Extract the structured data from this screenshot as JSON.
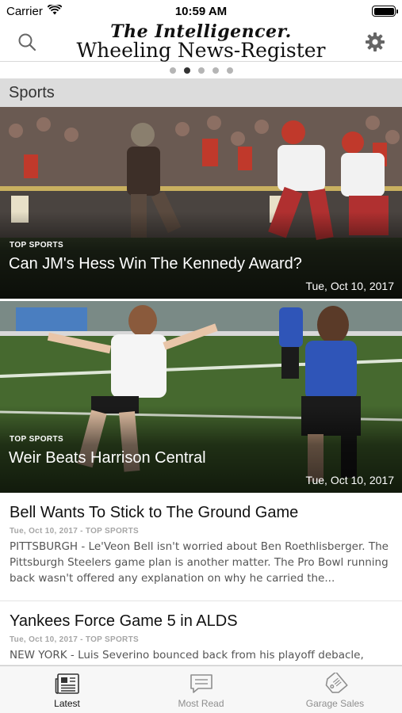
{
  "status_bar": {
    "carrier": "Carrier",
    "time": "10:59 AM"
  },
  "header": {
    "masthead_line1": "The Intelligencer.",
    "masthead_line2": "Wheeling News-Register",
    "left_icon": "search-icon",
    "right_icon": "gear-icon"
  },
  "page_indicator": {
    "count": 5,
    "active_index": 1
  },
  "section": {
    "title": "Sports"
  },
  "featured": [
    {
      "tag": "TOP SPORTS",
      "title": "Can JM's Hess Win The Kennedy Award?",
      "date": "Tue, Oct 10, 2017"
    },
    {
      "tag": "TOP SPORTS",
      "title": "Weir Beats Harrison Central",
      "date": "Tue, Oct 10, 2017"
    }
  ],
  "articles": [
    {
      "title": "Bell Wants To Stick to The Ground Game",
      "meta": "Tue, Oct 10, 2017 - TOP SPORTS",
      "snippet": "PITTSBURGH - Le'Veon Bell isn't worried about Ben Roethlisberger. The Pittsburgh Steelers game plan is another matter. The Pro Bowl running back wasn't offered any explanation on why he carried the..."
    },
    {
      "title": "Yankees Force Game 5 in ALDS",
      "meta": "Tue, Oct 10, 2017 - TOP SPORTS",
      "snippet": "NEW YORK - Luis Severino bounced back from his playoff debacle,"
    }
  ],
  "tabs": [
    {
      "label": "Latest",
      "icon": "newspaper-icon",
      "active": true
    },
    {
      "label": "Most Read",
      "icon": "chat-bubble-icon",
      "active": false
    },
    {
      "label": "Garage Sales",
      "icon": "price-tag-icon",
      "active": false
    }
  ],
  "colors": {
    "section_header_bg": "#dcdcdc",
    "active_dot": "#333333",
    "inactive_dot": "#b5b5b5",
    "tab_active": "#111111",
    "tab_inactive": "#8e8e8e"
  }
}
